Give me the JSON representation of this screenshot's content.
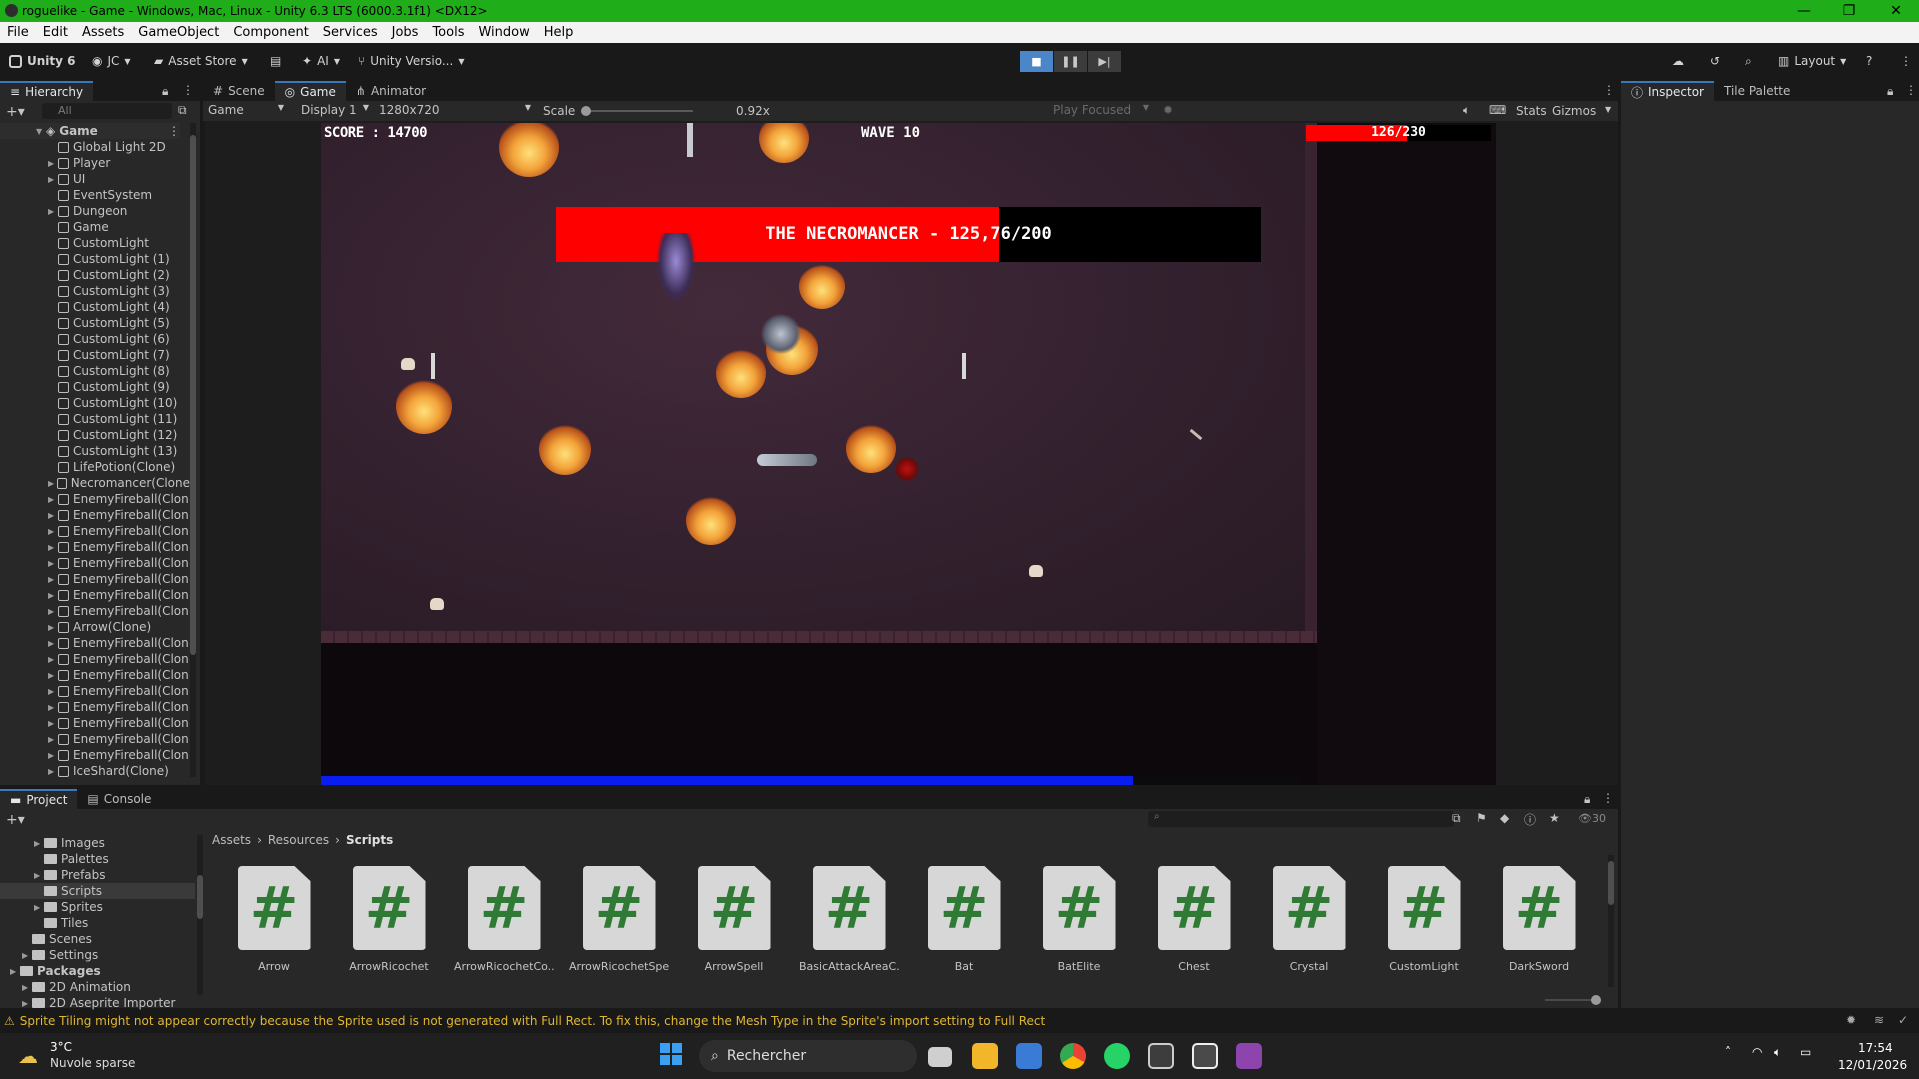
{
  "window": {
    "title": "roguelike - Game - Windows, Mac, Linux - Unity 6.3 LTS (6000.3.1f1) <DX12>",
    "controls": [
      "—",
      "❐",
      "✕"
    ]
  },
  "menu": [
    "File",
    "Edit",
    "Assets",
    "GameObject",
    "Component",
    "Services",
    "Jobs",
    "Tools",
    "Window",
    "Help"
  ],
  "toolbar": {
    "unity_label": "Unity 6",
    "account": "JC",
    "asset_store": "Asset Store",
    "ai": "AI",
    "version_control": "Unity Versio...",
    "layout": "Layout"
  },
  "hierarchy": {
    "tab": "Hierarchy",
    "search_placeholder": "All",
    "root": "Game",
    "items": [
      {
        "label": "Global Light 2D",
        "arrow": false
      },
      {
        "label": "Player",
        "arrow": true
      },
      {
        "label": "UI",
        "arrow": true
      },
      {
        "label": "EventSystem",
        "arrow": false
      },
      {
        "label": "Dungeon",
        "arrow": true
      },
      {
        "label": "Game",
        "arrow": false
      },
      {
        "label": "CustomLight",
        "arrow": false
      },
      {
        "label": "CustomLight (1)",
        "arrow": false
      },
      {
        "label": "CustomLight (2)",
        "arrow": false
      },
      {
        "label": "CustomLight (3)",
        "arrow": false
      },
      {
        "label": "CustomLight (4)",
        "arrow": false
      },
      {
        "label": "CustomLight (5)",
        "arrow": false
      },
      {
        "label": "CustomLight (6)",
        "arrow": false
      },
      {
        "label": "CustomLight (7)",
        "arrow": false
      },
      {
        "label": "CustomLight (8)",
        "arrow": false
      },
      {
        "label": "CustomLight (9)",
        "arrow": false
      },
      {
        "label": "CustomLight (10)",
        "arrow": false
      },
      {
        "label": "CustomLight (11)",
        "arrow": false
      },
      {
        "label": "CustomLight (12)",
        "arrow": false
      },
      {
        "label": "CustomLight (13)",
        "arrow": false
      },
      {
        "label": "LifePotion(Clone)",
        "arrow": false
      },
      {
        "label": "Necromancer(Clone",
        "arrow": true
      },
      {
        "label": "EnemyFireball(Clon",
        "arrow": true
      },
      {
        "label": "EnemyFireball(Clon",
        "arrow": true
      },
      {
        "label": "EnemyFireball(Clon",
        "arrow": true
      },
      {
        "label": "EnemyFireball(Clon",
        "arrow": true
      },
      {
        "label": "EnemyFireball(Clon",
        "arrow": true
      },
      {
        "label": "EnemyFireball(Clon",
        "arrow": true
      },
      {
        "label": "EnemyFireball(Clon",
        "arrow": true
      },
      {
        "label": "EnemyFireball(Clon",
        "arrow": true
      },
      {
        "label": "Arrow(Clone)",
        "arrow": true
      },
      {
        "label": "EnemyFireball(Clon",
        "arrow": true
      },
      {
        "label": "EnemyFireball(Clon",
        "arrow": true
      },
      {
        "label": "EnemyFireball(Clon",
        "arrow": true
      },
      {
        "label": "EnemyFireball(Clon",
        "arrow": true
      },
      {
        "label": "EnemyFireball(Clon",
        "arrow": true
      },
      {
        "label": "EnemyFireball(Clon",
        "arrow": true
      },
      {
        "label": "EnemyFireball(Clon",
        "arrow": true
      },
      {
        "label": "EnemyFireball(Clon",
        "arrow": true
      },
      {
        "label": "IceShard(Clone)",
        "arrow": true
      }
    ]
  },
  "center_tabs": [
    "Scene",
    "Game",
    "Animator"
  ],
  "game_toolbar": {
    "view": "Game",
    "display": "Display 1",
    "resolution": "1280x720",
    "scale_label": "Scale",
    "scale_value": "0.92x",
    "play_mode": "Play Focused",
    "stats": "Stats",
    "gizmos": "Gizmos"
  },
  "hud": {
    "score": "SCORE : 14700",
    "wave": "WAVE 10",
    "player_hp_text": "126/230",
    "player_hp_fraction": 0.548,
    "boss_text": "THE NECROMANCER - 125,76/200",
    "boss_hp_fraction": 0.629,
    "xp_fraction": 0.83
  },
  "inspector_tabs": [
    "Inspector",
    "Tile Palette"
  ],
  "bottom_tabs": [
    "Project",
    "Console"
  ],
  "project_tree": [
    {
      "label": "Images",
      "indent": 2,
      "arrow": true
    },
    {
      "label": "Palettes",
      "indent": 2,
      "arrow": false
    },
    {
      "label": "Prefabs",
      "indent": 2,
      "arrow": true
    },
    {
      "label": "Scripts",
      "indent": 2,
      "arrow": false,
      "selected": true
    },
    {
      "label": "Sprites",
      "indent": 2,
      "arrow": true
    },
    {
      "label": "Tiles",
      "indent": 2,
      "arrow": false
    },
    {
      "label": "Scenes",
      "indent": 1,
      "arrow": false
    },
    {
      "label": "Settings",
      "indent": 1,
      "arrow": true
    },
    {
      "label": "Packages",
      "indent": 0,
      "arrow": true
    },
    {
      "label": "2D Animation",
      "indent": 1,
      "arrow": true
    },
    {
      "label": "2D Aseprite Importer",
      "indent": 1,
      "arrow": true
    }
  ],
  "breadcrumb": [
    "Assets",
    "Resources",
    "Scripts"
  ],
  "project_count": "30",
  "assets": [
    "Arrow",
    "ArrowRicochet",
    "ArrowRicochetCo...",
    "ArrowRicochetSpell",
    "ArrowSpell",
    "BasicAttackAreaC...",
    "Bat",
    "BatElite",
    "Chest",
    "Crystal",
    "CustomLight",
    "DarkSword"
  ],
  "status_message": "Sprite Tiling might not appear correctly because the Sprite used is not generated with Full Rect. To fix this, change the Mesh Type in the Sprite's import setting to Full Rect",
  "taskbar": {
    "weather_temp": "3°C",
    "weather_desc": "Nuvole sparse",
    "search_placeholder": "Rechercher",
    "time": "17:54",
    "date": "12/01/2026"
  },
  "colors": {
    "titlebar": "#1fad1a",
    "hp_red": "#ff0000",
    "xp_blue": "#0a1df0",
    "script_hash": "#2f7a34"
  }
}
